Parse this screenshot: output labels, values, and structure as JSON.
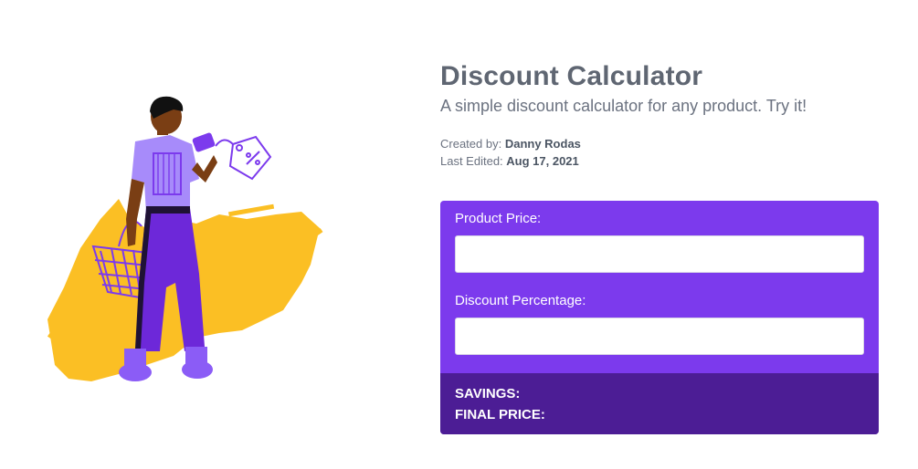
{
  "header": {
    "title": "Discount Calculator",
    "subtitle": "A simple discount calculator for any product. Try it!"
  },
  "meta": {
    "created_label": "Created by:",
    "created_value": "Danny Rodas",
    "edited_label": "Last Edited:",
    "edited_value": "Aug 17, 2021"
  },
  "calculator": {
    "price_label": "Product Price:",
    "price_value": "",
    "discount_label": "Discount Percentage:",
    "discount_value": "",
    "savings_label": "SAVINGS:",
    "final_label": "FINAL PRICE:"
  },
  "colors": {
    "accent": "#7c3aed",
    "accent_dark": "#4c1d95",
    "illustration_yellow": "#fbbf24",
    "skin": "#7a3e14"
  },
  "illustration": {
    "icon": "shopper-with-basket-illustration"
  }
}
